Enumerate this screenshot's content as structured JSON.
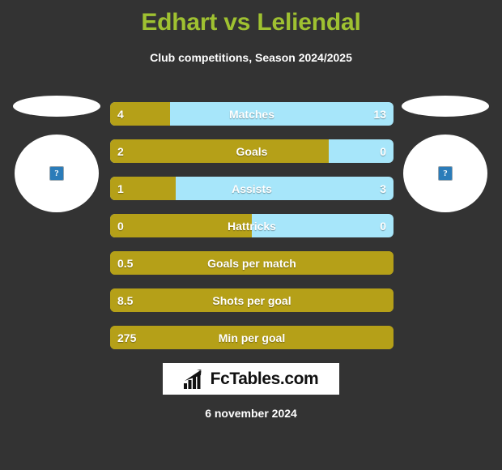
{
  "header": {
    "title": "Edhart vs Leliendal",
    "subtitle": "Club competitions, Season 2024/2025",
    "title_color": "#9fc131"
  },
  "colors": {
    "background": "#333333",
    "home_bar": "#b5a018",
    "away_bar": "#a7e6fa",
    "text": "#ffffff"
  },
  "players": {
    "home": {
      "name": "",
      "photo_icon": "broken-image-icon"
    },
    "away": {
      "name": "",
      "photo_icon": "broken-image-icon"
    }
  },
  "chart_data": {
    "type": "bar",
    "title": "Edhart vs Leliendal",
    "subtitle": "Club competitions, Season 2024/2025",
    "orientation": "horizontal-diverging",
    "series": [
      {
        "name": "Edhart",
        "color": "#b5a018"
      },
      {
        "name": "Leliendal",
        "color": "#a7e6fa"
      }
    ],
    "categories": [
      "Matches",
      "Goals",
      "Assists",
      "Hattricks",
      "Goals per match",
      "Shots per goal",
      "Min per goal"
    ],
    "rows": [
      {
        "label": "Matches",
        "home": "4",
        "away": "13",
        "home_pct": 21,
        "two_sided": true
      },
      {
        "label": "Goals",
        "home": "2",
        "away": "0",
        "home_pct": 77,
        "two_sided": true
      },
      {
        "label": "Assists",
        "home": "1",
        "away": "3",
        "home_pct": 23,
        "two_sided": true
      },
      {
        "label": "Hattricks",
        "home": "0",
        "away": "0",
        "home_pct": 50,
        "two_sided": true
      },
      {
        "label": "Goals per match",
        "home": "0.5",
        "away": "",
        "home_pct": 100,
        "two_sided": false
      },
      {
        "label": "Shots per goal",
        "home": "8.5",
        "away": "",
        "home_pct": 100,
        "two_sided": false
      },
      {
        "label": "Min per goal",
        "home": "275",
        "away": "",
        "home_pct": 100,
        "two_sided": false
      }
    ]
  },
  "footer": {
    "logo_text": "FcTables.com",
    "logo_icon": "bar-chart-arrow-icon",
    "date": "6 november 2024"
  }
}
